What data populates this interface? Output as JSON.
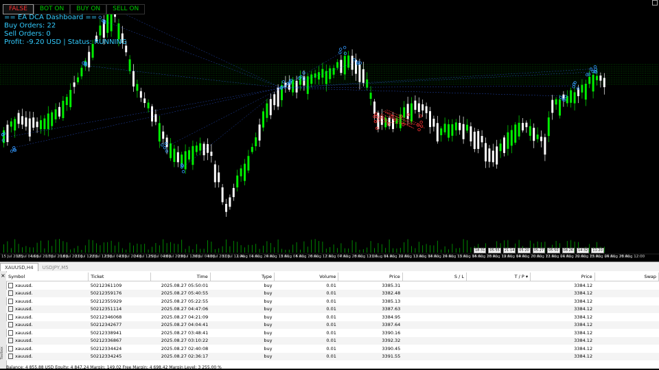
{
  "chart": {
    "top_buttons": [
      "FALSE",
      "BOT ON",
      "BUY ON",
      "SELL ON"
    ],
    "dashboard": {
      "title": "== EA DCA Dashboard ==",
      "buy_orders": "Buy Orders: 22",
      "sell_orders": "Sell Orders: 0",
      "profit_status": "Profit: -9.20 USD | Status: RUNNING"
    },
    "time_ticks": [
      "15 Jul 2025",
      "16 Jul 04:00",
      "16 Jul 20:00",
      "17 Jul 20:00",
      "18 Jul 20:00",
      "21 Jul 12:00",
      "22 Jul 12:00",
      "23 Jul 04:00",
      "23 Jul 20:00",
      "24 Jul 12:00",
      "25 Jul 04:00",
      "28 Jul 20:00",
      "29 Jul 12:00",
      "30 Jul 04:00",
      "30 Jul 20:00",
      "31 Jul 12:00",
      "1 Aug 04:00",
      "1 Aug 20:00",
      "4 Aug 12:00",
      "5 Aug 04:00",
      "5 Aug 20:00",
      "6 Aug 12:00",
      "7 Aug 04:00",
      "7 Aug 20:00",
      "8 Aug 12:00",
      "11 Aug 04:00",
      "11 Aug 20:00",
      "12 Aug 12:00",
      "13 Aug 04:00",
      "13 Aug 20:00",
      "14 Aug 12:00",
      "15 Aug 04:00",
      "15 Aug 20:00",
      "18 Aug 12:00",
      "19 Aug 04:00",
      "19 Aug 20:00",
      "20 Aug 12:00",
      "21 Aug 04:00",
      "21 Aug 20:00",
      "22 Aug 12:00",
      "25 Aug 04:00",
      "25 Aug 20:00",
      "26 Aug 12:00"
    ],
    "trade_labels": [
      "18:31",
      "05:55",
      "21:14",
      "05:20",
      "05:27",
      "05:50",
      "08:26",
      "14:32",
      "11:20"
    ],
    "colors": {
      "bull": "#00ee00",
      "bear": "#ffffff",
      "buy_marker": "#3399ff",
      "sell_marker": "#ff3333",
      "grid_line": "#00cc00",
      "dash_text": "#33ccff"
    }
  },
  "tabs": [
    "XAUUSD,H4",
    "USDJPY,M5"
  ],
  "table": {
    "headers": [
      "Symbol",
      "Ticket",
      "Time",
      "Type",
      "Volume",
      "Price",
      "S / L",
      "T / P",
      "Price",
      "Swap"
    ],
    "rows": [
      [
        "xauusd.",
        "50212361109",
        "2025.08.27 05:50:01",
        "buy",
        "0.01",
        "3385.31",
        "",
        "",
        "3384.12",
        ""
      ],
      [
        "xauusd.",
        "50212359176",
        "2025.08.27 05:40:55",
        "buy",
        "0.01",
        "3382.48",
        "",
        "",
        "3384.12",
        ""
      ],
      [
        "xauusd.",
        "50212355929",
        "2025.08.27 05:22:55",
        "buy",
        "0.01",
        "3385.13",
        "",
        "",
        "3384.12",
        ""
      ],
      [
        "xauusd.",
        "50212351114",
        "2025.08.27 04:47:06",
        "buy",
        "0.01",
        "3387.63",
        "",
        "",
        "3384.12",
        ""
      ],
      [
        "xauusd.",
        "50212346068",
        "2025.08.27 04:21:09",
        "buy",
        "0.01",
        "3384.95",
        "",
        "",
        "3384.12",
        ""
      ],
      [
        "xauusd.",
        "50212342677",
        "2025.08.27 04:04:41",
        "buy",
        "0.01",
        "3387.64",
        "",
        "",
        "3384.12",
        ""
      ],
      [
        "xauusd.",
        "50212338941",
        "2025.08.27 03:48:41",
        "buy",
        "0.01",
        "3390.16",
        "",
        "",
        "3384.12",
        ""
      ],
      [
        "xauusd.",
        "50212336867",
        "2025.08.27 03:10:22",
        "buy",
        "0.01",
        "3392.32",
        "",
        "",
        "3384.12",
        ""
      ],
      [
        "xauusd.",
        "50212334424",
        "2025.08.27 02:40:08",
        "buy",
        "0.01",
        "3390.45",
        "",
        "",
        "3384.12",
        ""
      ],
      [
        "xauusd.",
        "50212334245",
        "2025.08.27 02:36:17",
        "buy",
        "0.01",
        "3391.55",
        "",
        "",
        "3384.12",
        ""
      ]
    ],
    "status": "Balance: 4 855.88 USD  Equity: 4 847.24  Margin: 149.02  Free Margin: 4 698.42  Margin Level: 3 255.00 %"
  },
  "sidebar": {
    "close": "×",
    "label": "Toolbox"
  }
}
